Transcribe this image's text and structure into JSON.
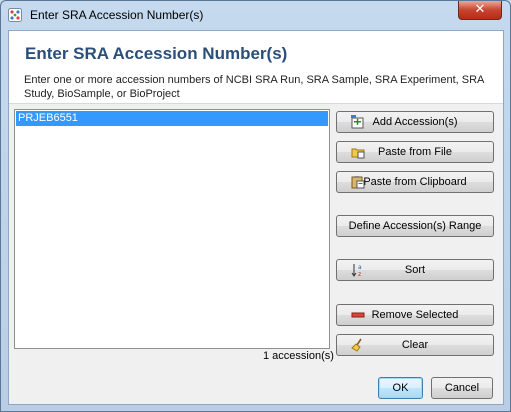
{
  "window": {
    "title": "Enter SRA Accession Number(s)",
    "close_glyph": "✕"
  },
  "header": {
    "heading": "Enter SRA Accession Number(s)",
    "description": "Enter one or more accession numbers of NCBI SRA Run, SRA Sample, SRA Experiment, SRA Study, BioSample, or BioProject"
  },
  "accessions": {
    "items": [
      "PRJEB6551"
    ],
    "count_label": "1 accession(s)"
  },
  "actions": {
    "add": "Add Accession(s)",
    "paste_file": "Paste from File",
    "paste_clipboard": "Paste from Clipboard",
    "define_range": "Define Accession(s) Range",
    "sort": "Sort",
    "remove": "Remove Selected",
    "clear": "Clear"
  },
  "footer": {
    "ok": "OK",
    "cancel": "Cancel"
  },
  "colors": {
    "accent": "#3399ff",
    "heading": "#2b4f7a"
  }
}
